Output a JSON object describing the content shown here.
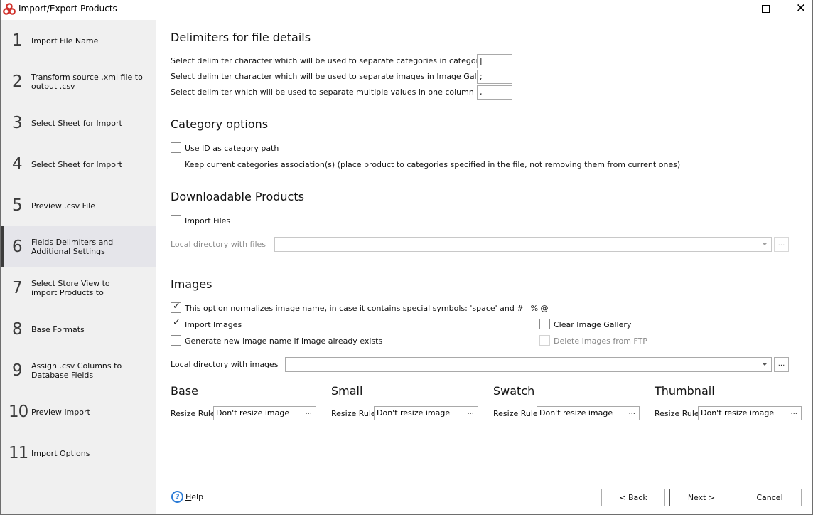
{
  "window": {
    "title": "Import/Export Products",
    "maximize_icon": "maximize-icon",
    "close_glyph": "✕"
  },
  "sidebar": {
    "steps": [
      {
        "num": "1",
        "label": "Import File Name",
        "active": false
      },
      {
        "num": "2",
        "label": "Transform source .xml file to output .csv",
        "active": false
      },
      {
        "num": "3",
        "label": "Select Sheet for Import",
        "active": false
      },
      {
        "num": "4",
        "label": "Select Sheet for Import",
        "active": false
      },
      {
        "num": "5",
        "label": "Preview .csv File",
        "active": false
      },
      {
        "num": "6",
        "label": "Fields Delimiters and Additional Settings",
        "active": true
      },
      {
        "num": "7",
        "label": "Select Store View to import Products to",
        "active": false
      },
      {
        "num": "8",
        "label": "Base Formats",
        "active": false
      },
      {
        "num": "9",
        "label": "Assign .csv Columns to Database Fields",
        "active": false
      },
      {
        "num": "10",
        "label": "Preview Import",
        "active": false
      },
      {
        "num": "11",
        "label": "Import Options",
        "active": false
      }
    ]
  },
  "delimiters": {
    "heading": "Delimiters for file details",
    "rows": [
      {
        "label": "Select delimiter character which will be used to separate categories in category tree",
        "value": "|"
      },
      {
        "label": "Select delimiter character which will be used to separate images in Image Gallery",
        "value": ";"
      },
      {
        "label": "Select delimiter which will be used to separate multiple values in one column",
        "value": ","
      }
    ]
  },
  "category": {
    "heading": "Category options",
    "use_id": {
      "label": "Use ID as category path",
      "checked": false
    },
    "keep_assoc": {
      "label": "Keep current categories association(s) (place product to categories specified in the file, not removing them from current ones)",
      "checked": false
    }
  },
  "downloadable": {
    "heading": "Downloadable Products",
    "import_files": {
      "label": "Import Files",
      "checked": false
    },
    "local_dir_label": "Local directory with files",
    "local_dir_value": "",
    "browse_label": "..."
  },
  "images": {
    "heading": "Images",
    "normalize": {
      "label": "This option normalizes image name, in case it contains special symbols: 'space' and # ' % @",
      "checked": true
    },
    "import_images": {
      "label": "Import Images",
      "checked": true
    },
    "generate_name": {
      "label": "Generate new image name if image already exists",
      "checked": false
    },
    "clear_gallery": {
      "label": "Clear Image Gallery",
      "checked": false
    },
    "delete_ftp": {
      "label": "Delete Images from FTP",
      "checked": false,
      "disabled": true
    },
    "local_dir_label": "Local directory with images",
    "local_dir_value": "",
    "browse_label": "...",
    "check_glyph": "✓"
  },
  "resize": {
    "rule_label": "Resize Rule",
    "ellipsis": "...",
    "groups": [
      {
        "title": "Base",
        "value": "Don't resize image"
      },
      {
        "title": "Small",
        "value": "Don't resize image"
      },
      {
        "title": "Swatch",
        "value": "Don't resize image"
      },
      {
        "title": "Thumbnail",
        "value": "Don't resize image"
      }
    ]
  },
  "footer": {
    "help_glyph": "?",
    "help_label_first": "H",
    "help_label_rest": "elp",
    "back_prefix": "< ",
    "back_first": "B",
    "back_rest": "ack",
    "next_first": "N",
    "next_rest": "ext >",
    "cancel_first": "C",
    "cancel_rest": "ancel"
  }
}
